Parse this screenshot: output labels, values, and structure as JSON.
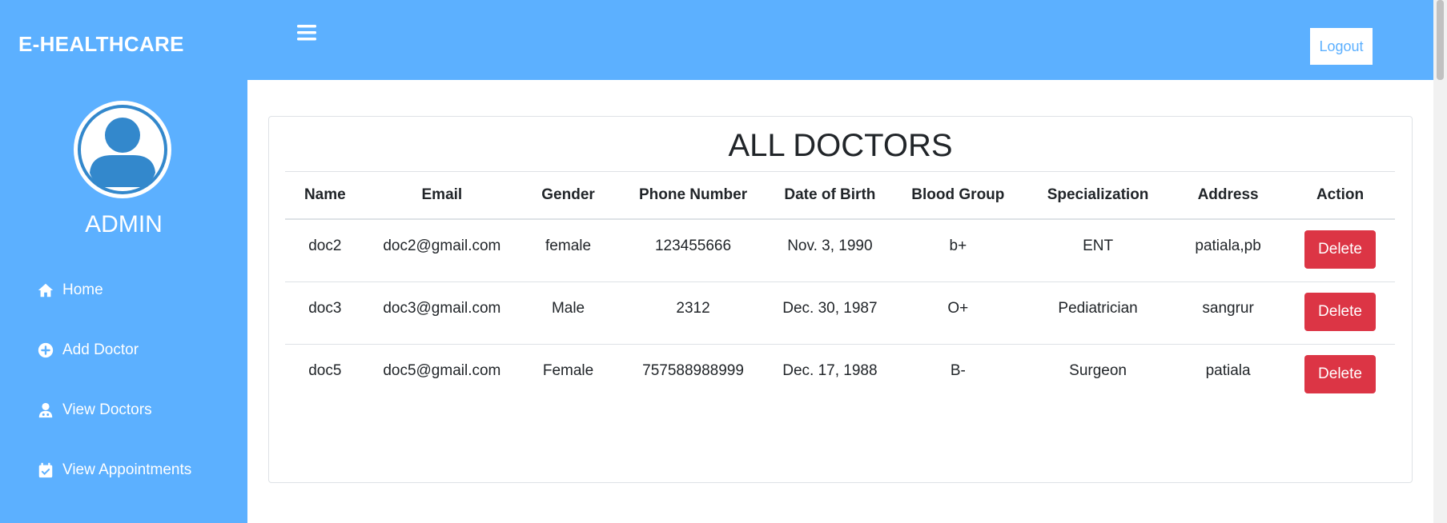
{
  "brand": "E-HEALTHCARE",
  "sidebar": {
    "user_label": "ADMIN",
    "items": [
      {
        "label": "Home",
        "icon": "home-icon"
      },
      {
        "label": "Add Doctor",
        "icon": "plus-circle-icon"
      },
      {
        "label": "View Doctors",
        "icon": "user-doctor-icon"
      },
      {
        "label": "View Appointments",
        "icon": "calendar-check-icon"
      }
    ]
  },
  "header": {
    "logout_label": "Logout"
  },
  "main": {
    "title": "ALL DOCTORS",
    "columns": [
      "Name",
      "Email",
      "Gender",
      "Phone Number",
      "Date of Birth",
      "Blood Group",
      "Specialization",
      "Address",
      "Action"
    ],
    "rows": [
      [
        "doc2",
        "doc2@gmail.com",
        "female",
        "123455666",
        "Nov. 3, 1990",
        "b+",
        "ENT",
        "patiala,pb",
        "Delete"
      ],
      [
        "doc3",
        "doc3@gmail.com",
        "Male",
        "2312",
        "Dec. 30, 1987",
        "O+",
        "Pediatrician",
        "sangrur",
        "Delete"
      ],
      [
        "doc5",
        "doc5@gmail.com",
        "Female",
        "757588988999",
        "Dec. 17, 1988",
        "B-",
        "Surgeon",
        "patiala",
        "Delete"
      ]
    ]
  },
  "colors": {
    "primary": "#5cb0ff",
    "danger": "#dc3545",
    "avatar": "#3388cc"
  }
}
